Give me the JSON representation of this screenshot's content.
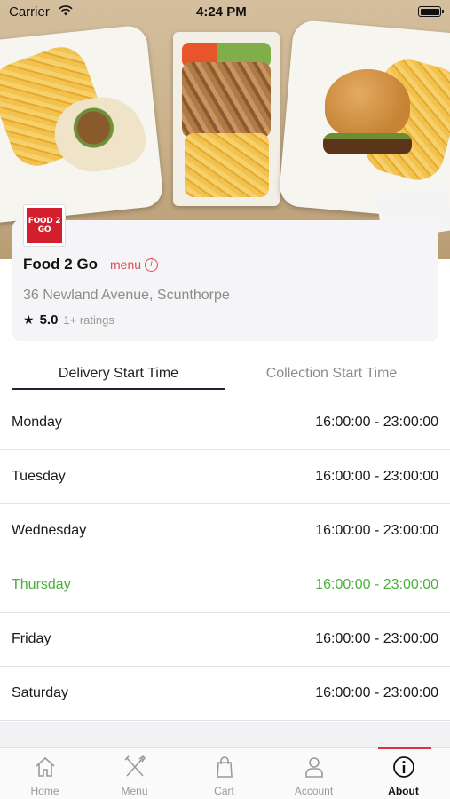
{
  "status_bar": {
    "carrier": "Carrier",
    "time": "4:24 PM"
  },
  "restaurant": {
    "logo_text": "FOOD 2 GO",
    "name": "Food 2 Go",
    "menu_label": "menu",
    "address": "36 Newland Avenue, Scunthorpe",
    "rating": "5.0",
    "rating_count": "1+ ratings"
  },
  "tabs": [
    {
      "label": "Delivery Start Time",
      "active": true
    },
    {
      "label": "Collection Start Time",
      "active": false
    }
  ],
  "schedule": [
    {
      "day": "Monday",
      "hours": "16:00:00 - 23:00:00"
    },
    {
      "day": "Tuesday",
      "hours": "16:00:00 - 23:00:00"
    },
    {
      "day": "Wednesday",
      "hours": "16:00:00 - 23:00:00"
    },
    {
      "day": "Thursday",
      "hours": "16:00:00 - 23:00:00",
      "highlight": true
    },
    {
      "day": "Friday",
      "hours": "16:00:00 - 23:00:00"
    },
    {
      "day": "Saturday",
      "hours": "16:00:00 - 23:00:00"
    }
  ],
  "tab_bar": [
    {
      "label": "Home",
      "icon": "home-icon"
    },
    {
      "label": "Menu",
      "icon": "utensils-icon"
    },
    {
      "label": "Cart",
      "icon": "shopping-bag-icon"
    },
    {
      "label": "Account",
      "icon": "person-icon"
    },
    {
      "label": "About",
      "icon": "info-circle-icon",
      "active": true
    }
  ],
  "colors": {
    "accent_red": "#e0313b",
    "today_green": "#4caf3e",
    "tab_underline": "#1e2433"
  }
}
